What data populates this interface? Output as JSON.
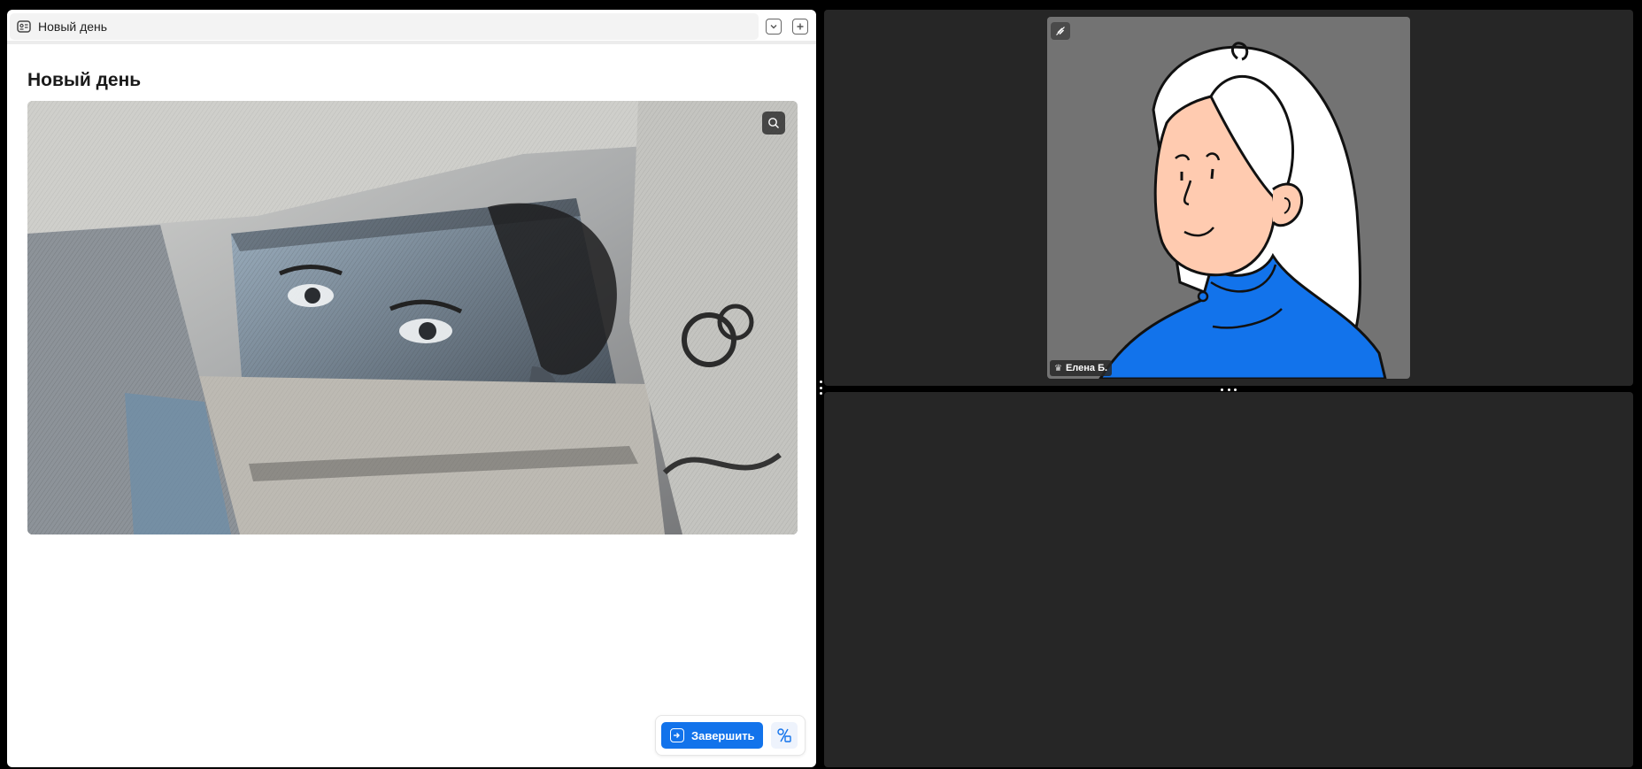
{
  "document": {
    "tab_title": "Новый день",
    "page_title": "Новый день",
    "hero_image_alt": "",
    "actions": {
      "finish_label": "Завершить"
    }
  },
  "video": {
    "participant": {
      "name": "Елена Б."
    }
  },
  "colors": {
    "primary": "#1273eb",
    "panel_dark": "#262626",
    "tile_bg": "#737373",
    "sweater": "#1273eb",
    "skin": "#ffcbb0"
  },
  "icons": {
    "tab": "document-card-icon",
    "collapse": "chevron-down-icon",
    "add": "plus-icon",
    "zoom": "search-icon",
    "finish": "exit-icon",
    "tools": "shapes-icon",
    "badge": "no-audio-icon",
    "host": "crown-icon"
  }
}
